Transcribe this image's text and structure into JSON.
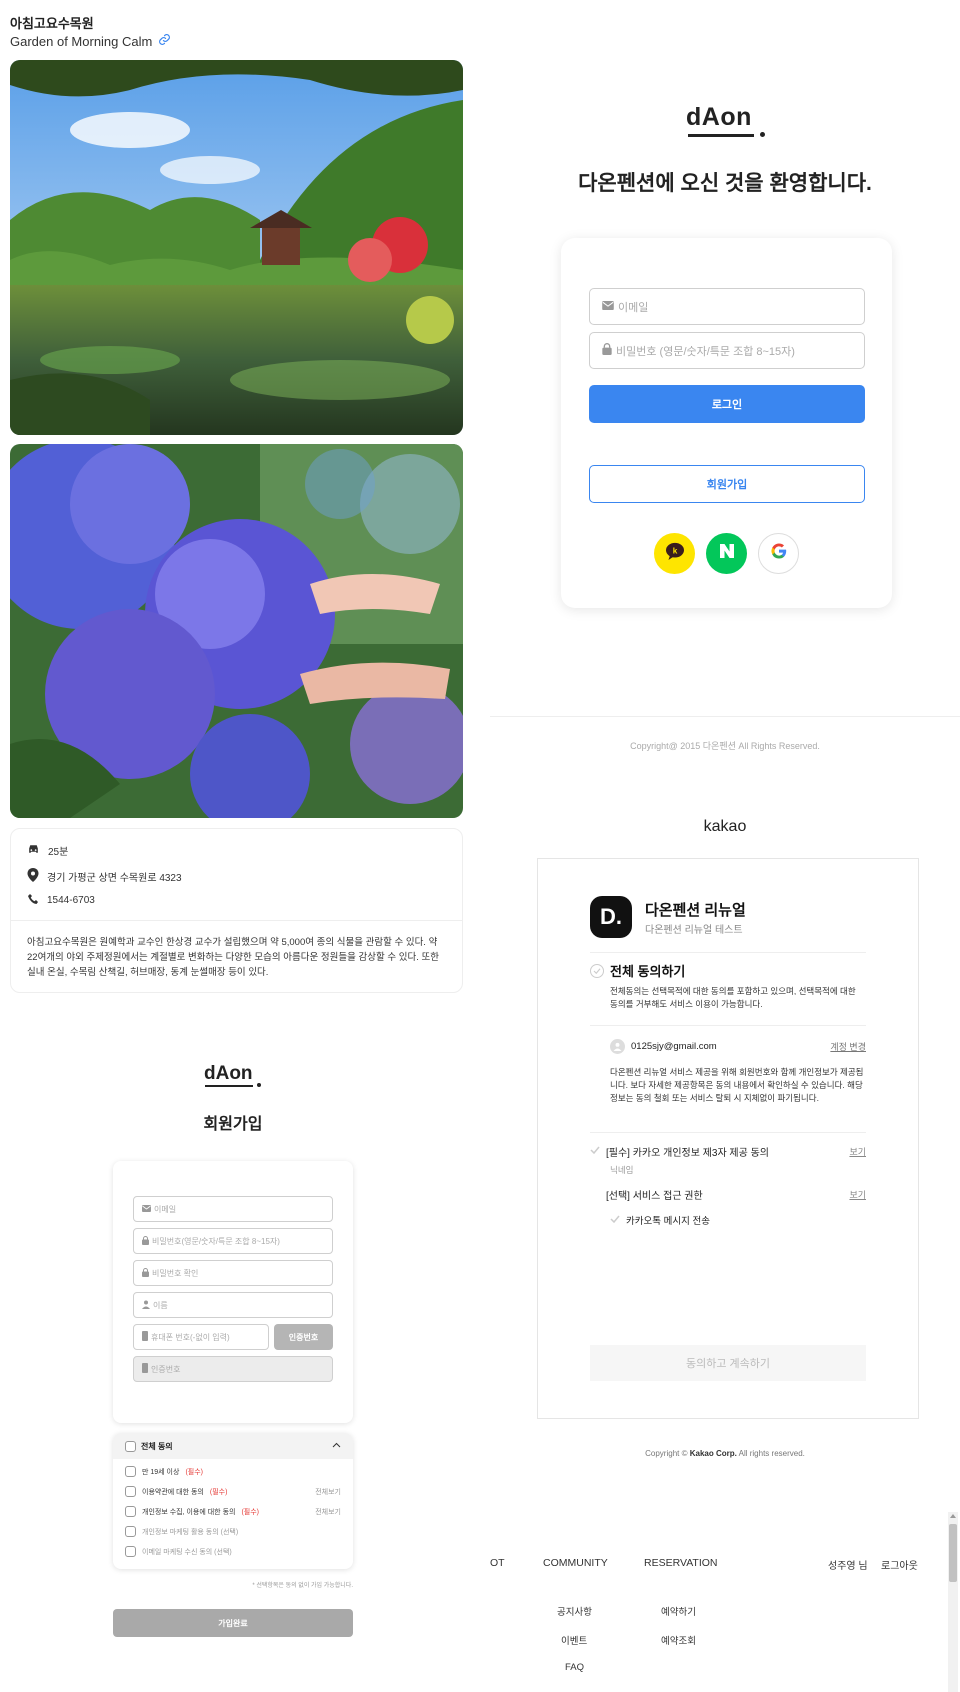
{
  "place": {
    "title": "아침고요수목원",
    "subtitle": "Garden of Morning Calm",
    "drive_time": "25분",
    "address": "경기 가평군 상면 수목원로 4323",
    "phone": "1544-6703",
    "description": "아침고요수목원은 원예학과 교수인 한상경 교수가 설립했으며 약 5,000여 종의 식물을 관람할 수 있다. 약 22여개의 야외 주제정원에서는 계절별로 변화하는 다양한 모습의 아름다운 정원들을 감상할 수 있다. 또한 실내 온실, 수목림 산책길, 허브매장, 동계 눈썰매장 등이 있다."
  },
  "login": {
    "logo": "dAon",
    "title": "다온펜션에 오신 것을 환영합니다.",
    "email_placeholder": "이메일",
    "password_placeholder": "비밀번호 (영문/숫자/특문 조합 8~15자)",
    "login_button": "로그인",
    "signup_button": "회원가입",
    "social": [
      "kakao-icon",
      "naver-icon",
      "google-icon"
    ],
    "copyright": "Copyright@ 2015 다온펜션 All Rights Reserved.",
    "colors": {
      "accent": "#3a86f0",
      "kakao": "#fee500",
      "naver": "#03c75a"
    }
  },
  "signup": {
    "logo": "dAon",
    "title": "회원가입",
    "email_placeholder": "이메일",
    "password_placeholder": "비밀번호(영문/숫자/특문 조합 8~15자)",
    "password_confirm_placeholder": "비밀번호 확인",
    "name_placeholder": "이름",
    "phone_placeholder": "휴대폰 번호(-없이 입력)",
    "verify_button": "인증번호",
    "code_placeholder": "인증번호",
    "agree_all": "전체 동의",
    "agreements": [
      {
        "label": "만 19세 이상",
        "tag": "(필수)",
        "more": ""
      },
      {
        "label": "이용약관에 대한 동의",
        "tag": "(필수)",
        "more": "전체보기"
      },
      {
        "label": "개인정보 수집, 이용에 대한 동의",
        "tag": "(필수)",
        "more": "전체보기"
      },
      {
        "label": "개인정보 마케팅 활용 동의 (선택)",
        "tag": "",
        "more": ""
      },
      {
        "label": "이메일 마케팅 수신 동의 (선택)",
        "tag": "",
        "more": ""
      }
    ],
    "note": "* 선택항목은 동의 없이 가입 가능합니다.",
    "submit": "가입완료"
  },
  "kakao": {
    "brand": "kakao",
    "app_logo": "D.",
    "app_name": "다온펜션 리뉴얼",
    "app_desc": "다온펜션 리뉴얼 테스트",
    "agree_all": "전체 동의하기",
    "agree_all_desc": "전체동의는 선택목적에 대한 동의를 포함하고 있으며, 선택목적에 대한 동의를 거부해도 서비스 이용이 가능합니다.",
    "account_email": "0125sjy@gmail.com",
    "account_change": "계정 변경",
    "account_desc": "다온펜션 리뉴얼 서비스 제공을 위해 회원번호와 함께 개인정보가 제공됩니다. 보다 자세한 제공항목은 동의 내용에서 확인하실 수 있습니다. 해당 정보는 동의 철회 또는 서비스 탈퇴 시 지체없이 파기됩니다.",
    "item_required": "[필수] 카카오 개인정보 제3자 제공 동의",
    "item_required_sub": "닉네임",
    "item_optional": "[선택] 서비스 접근 권한",
    "item_optional_sub": "카카오톡 메시지 전송",
    "see": "보기",
    "continue": "동의하고 계속하기",
    "copyright_pre": "Copyright ©",
    "copyright_brand": "Kakao Corp.",
    "copyright_post": "All rights reserved."
  },
  "site_nav": {
    "items": [
      "OT",
      "COMMUNITY",
      "RESERVATION"
    ],
    "user": "성주영 님",
    "logout": "로그아웃",
    "community_sub": [
      "공지사항",
      "이벤트",
      "FAQ"
    ],
    "reservation_sub": [
      "예약하기",
      "예약조회"
    ]
  }
}
